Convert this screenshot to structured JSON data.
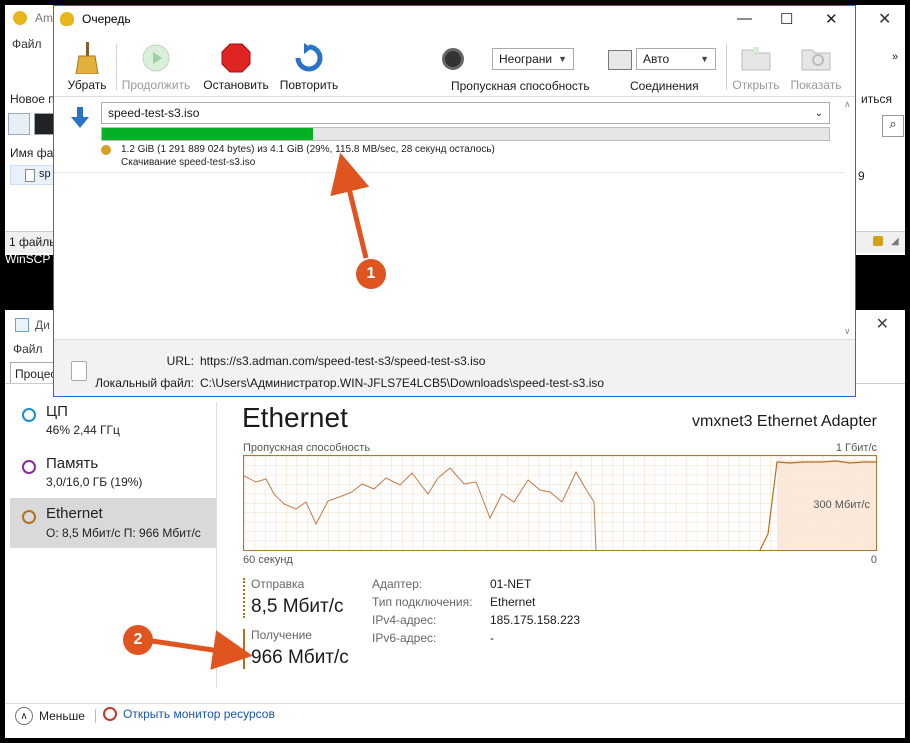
{
  "winscp": {
    "title_partial": "Am",
    "menu_partial": "Файл",
    "toolbar_partial": "Новое п",
    "right_partial": "иться",
    "colhdr_partial": "Имя фай",
    "row_partial": "sp",
    "row_right_partial": "9",
    "status_partial": "1 файлы",
    "taskbar_label": "WinSCP"
  },
  "queue": {
    "title": "Очередь",
    "toolbar": {
      "remove": "Убрать",
      "resume": "Продолжить",
      "stop": "Остановить",
      "retry": "Повторить",
      "open": "Открыть",
      "show": "Показать"
    },
    "bandwidth": {
      "value": "Неограни",
      "caption": "Пропускная способность"
    },
    "connections": {
      "value": "Авто",
      "caption": "Соединения"
    },
    "item": {
      "file": "speed-test-s3.iso",
      "progress": 0.29,
      "info": "1.2 GiB (1 291 889 024 bytes) из 4.1 GiB (29%, 115.8 MB/sec, 28 секунд осталось)",
      "status": "Скачивание speed-test-s3.iso"
    },
    "details": {
      "url_label": "URL:",
      "url_value": "https://s3.adman.com/speed-test-s3/speed-test-s3.iso",
      "local_label": "Локальный файл:",
      "local_value": "C:\\Users\\Администратор.WIN-JFLS7E4LCB5\\Downloads\\speed-test-s3.iso"
    }
  },
  "taskmgr": {
    "title_partial": "Ди",
    "menu_partial": "Файл",
    "tab_partial": "Процес",
    "sidebar": [
      {
        "name": "ЦП",
        "sub": "46% 2,44 ГГц",
        "color": "#1a8fc9"
      },
      {
        "name": "Память",
        "sub": "3,0/16,0 ГБ (19%)",
        "color": "#8b2a9e"
      },
      {
        "name": "Ethernet",
        "sub": "О: 8,5 Мбит/с П: 966 Мбит/с",
        "color": "#b5701f"
      }
    ],
    "ethernet": {
      "title": "Ethernet",
      "adapter": "vmxnet3 Ethernet Adapter",
      "graph_label": "Пропускная способность",
      "graph_max": "1 Гбит/с",
      "graph_mid": "300 Мбит/с",
      "time_left": "60 секунд",
      "time_right": "0",
      "send_label": "Отправка",
      "send_value": "8,5 Мбит/с",
      "recv_label": "Получение",
      "recv_value": "966 Мбит/с",
      "kv": [
        {
          "k": "Адаптер:",
          "v": "01-NET"
        },
        {
          "k": "Тип подключения:",
          "v": "Ethernet"
        },
        {
          "k": "IPv4-адрес:",
          "v": "185.175.158.223"
        },
        {
          "k": "IPv6-адрес:",
          "v": "-"
        }
      ]
    },
    "footer": {
      "less": "Меньше",
      "resmon": "Открыть монитор ресурсов"
    }
  },
  "annotations": {
    "one": "1",
    "two": "2"
  },
  "colors": {
    "progress": "#06b025",
    "accent": "#e0541f",
    "ethernet": "#b5701f"
  }
}
